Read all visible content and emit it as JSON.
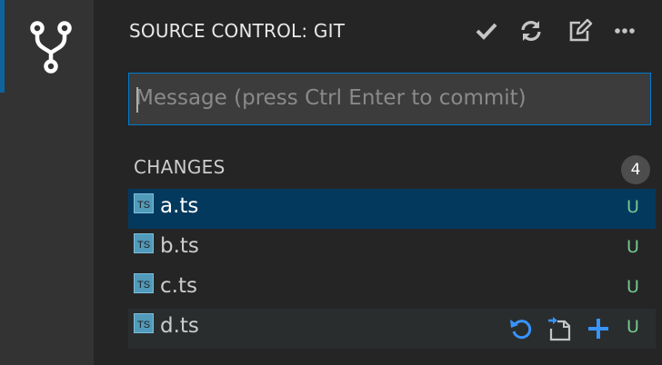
{
  "activity_bar": {
    "active_view_icon": "source-control-icon",
    "accent_color": "#0e639c"
  },
  "header": {
    "title": "SOURCE CONTROL: GIT",
    "actions": [
      {
        "icon": "checkmark-icon",
        "name": "commit"
      },
      {
        "icon": "refresh-icon",
        "name": "refresh"
      },
      {
        "icon": "edit-icon",
        "name": "open-changes"
      },
      {
        "icon": "ellipsis-icon",
        "name": "more-actions"
      }
    ]
  },
  "commit": {
    "placeholder": "Message (press Ctrl Enter to commit)",
    "value": "",
    "border_color": "#007acc"
  },
  "changes": {
    "label": "CHANGES",
    "count": "4",
    "files": [
      {
        "name": "a.ts",
        "status": "U",
        "icon": "typescript-file-icon",
        "state": "selected"
      },
      {
        "name": "b.ts",
        "status": "U",
        "icon": "typescript-file-icon",
        "state": "normal"
      },
      {
        "name": "c.ts",
        "status": "U",
        "icon": "typescript-file-icon",
        "state": "normal"
      },
      {
        "name": "d.ts",
        "status": "U",
        "icon": "typescript-file-icon",
        "state": "hovered",
        "row_actions": [
          {
            "icon": "discard-changes-icon",
            "name": "discard"
          },
          {
            "icon": "open-file-icon",
            "name": "open-file"
          },
          {
            "icon": "plus-icon",
            "name": "stage"
          }
        ]
      }
    ],
    "status_color": "#73c991",
    "selection_color": "#04395e"
  }
}
